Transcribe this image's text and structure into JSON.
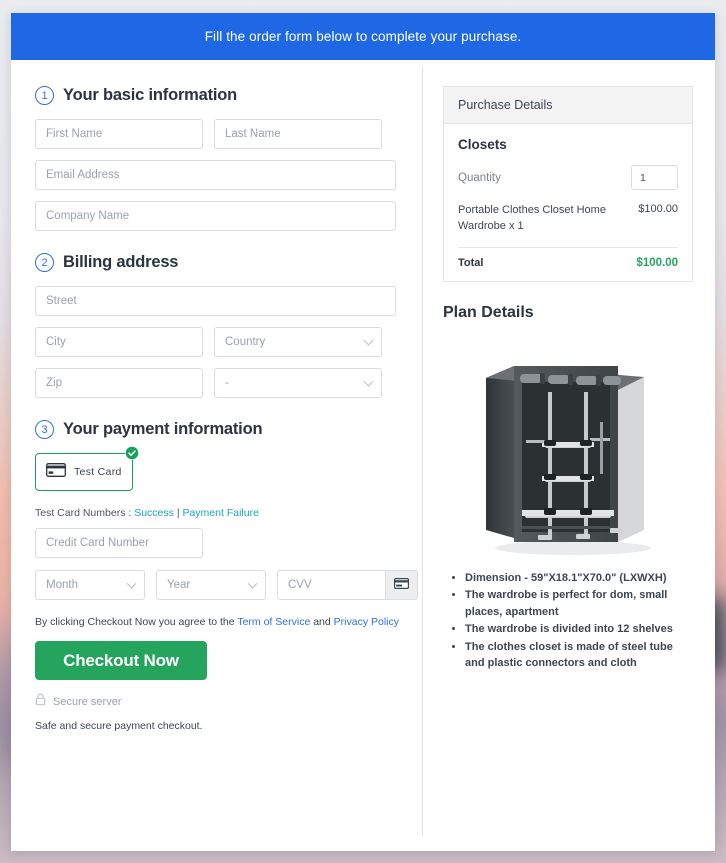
{
  "banner": {
    "text": "Fill the order form below to complete your purchase."
  },
  "sections": {
    "basic": {
      "number": "1",
      "title": "Your basic information",
      "fields": {
        "first_name": "First Name",
        "last_name": "Last Name",
        "email": "Email Address",
        "company": "Company Name"
      }
    },
    "billing": {
      "number": "2",
      "title": "Billing address",
      "fields": {
        "street": "Street",
        "city": "City",
        "country": "Country",
        "zip": "Zip",
        "state": "-"
      }
    },
    "payment": {
      "number": "3",
      "title": "Your payment information",
      "test_card_label": "Test Card",
      "test_numbers_label": "Test Card Numbers :",
      "test_numbers_success": "Success",
      "test_numbers_separator": "|",
      "test_numbers_failure": "Payment Failure",
      "fields": {
        "card_number": "Credit Card Number",
        "month": "Month",
        "year": "Year",
        "cvv": "CVV"
      }
    }
  },
  "terms": {
    "prefix": "By clicking Checkout Now you agree to the",
    "tos": "Term of Service",
    "conjunction": "and",
    "privacy": "Privacy Policy"
  },
  "checkout_button": "Checkout Now",
  "secure_server": "Secure server",
  "safe_note": "Safe and secure payment checkout.",
  "purchase": {
    "panel_title": "Purchase Details",
    "product_group": "Closets",
    "quantity_label": "Quantity",
    "quantity_value": "1",
    "line_item_name": "Portable Clothes Closet Home Wardrobe x 1",
    "line_item_price": "$100.00",
    "total_label": "Total",
    "total_value": "$100.00"
  },
  "plan": {
    "title": "Plan Details",
    "features": [
      "Dimension - 59\"X18.1\"X70.0\" (LXWXH)",
      "The wardrobe is perfect for dom, small places, apartment",
      "The wardrobe is divided into 12 shelves",
      "The clothes closet is made of steel tube and plastic connectors and cloth"
    ]
  },
  "colors": {
    "banner_blue": "#1f68e5",
    "accent_blue": "#2f6fe0",
    "success_green": "#25a45e",
    "test_card_green": "#17a05e",
    "link_teal": "#18a9b4"
  }
}
